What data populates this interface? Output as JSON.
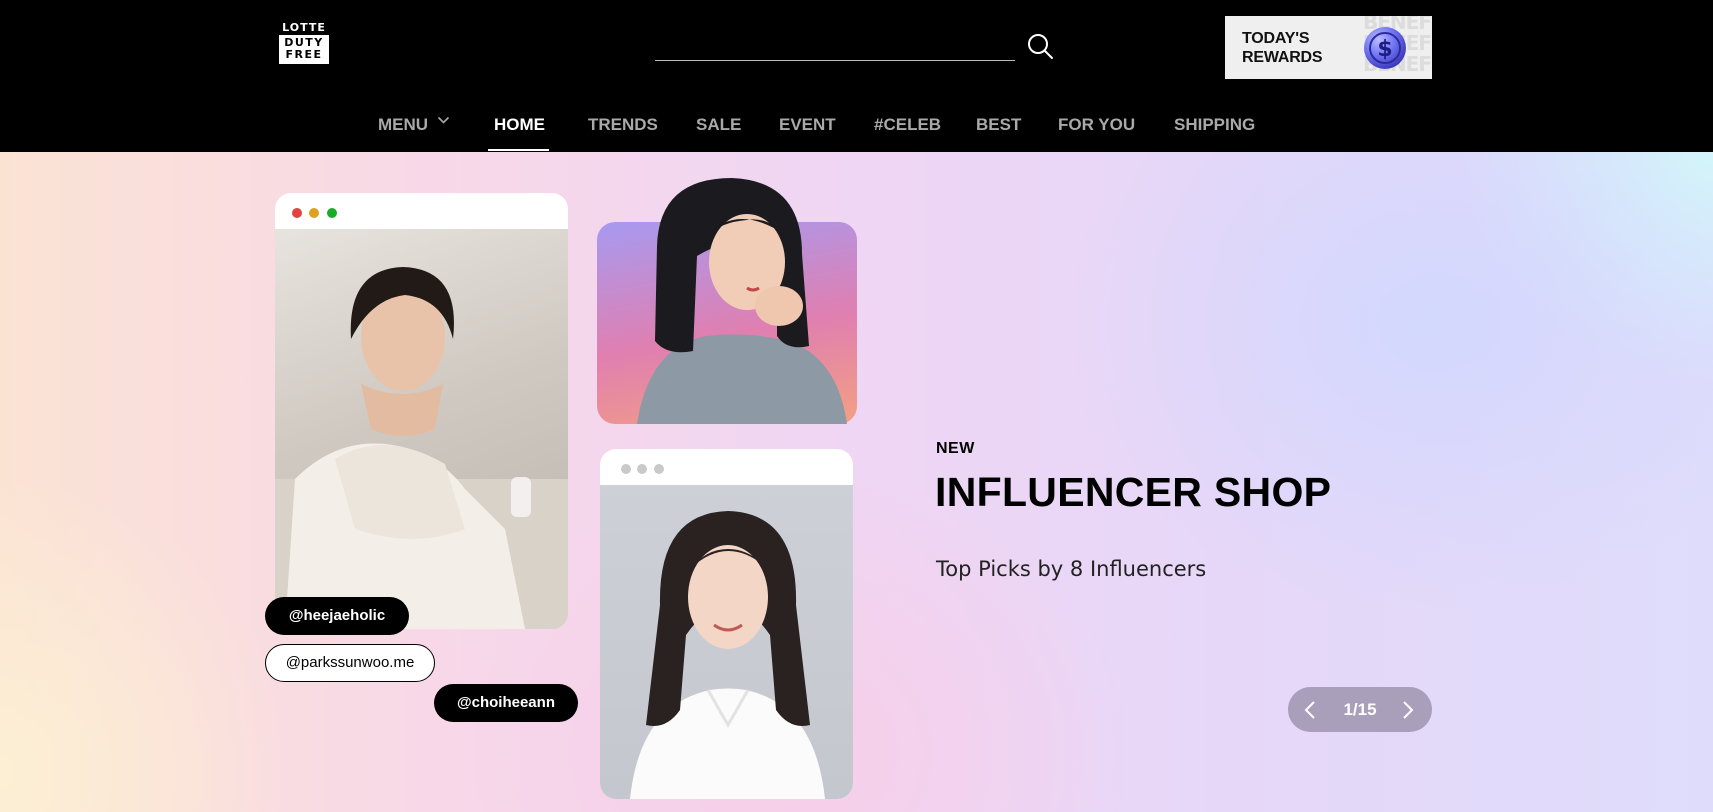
{
  "brand": {
    "logo_top": "LOTTE",
    "logo_line1": "DUTY",
    "logo_line2": "FREE"
  },
  "search": {
    "value": "",
    "placeholder": "",
    "icon": "search-icon"
  },
  "rewards_banner": {
    "line1": "TODAY'S",
    "line2": "REWARDS",
    "background_text": [
      "BENEFITS",
      "BENEFITS",
      "BENEFITS"
    ],
    "icon": "dollar-coin-icon",
    "coin_color": "#6a6ff0"
  },
  "nav": {
    "items": [
      {
        "label": "MENU"
      },
      {
        "label": "HOME"
      },
      {
        "label": "TRENDS"
      },
      {
        "label": "SALE"
      },
      {
        "label": "EVENT"
      },
      {
        "label": "#CELEB"
      },
      {
        "label": "BEST"
      },
      {
        "label": "FOR YOU"
      },
      {
        "label": "SHIPPING"
      }
    ],
    "active": "HOME"
  },
  "hero": {
    "eyebrow": "NEW",
    "title": "INFLUENCER SHOP",
    "subtitle": "Top Picks by 8 Influencers",
    "tags": [
      "@heejaeholic",
      "@parkssunwoo.me",
      "@choiheeann"
    ],
    "window_dot_colors": [
      "#e0443e",
      "#dea123",
      "#1aab29"
    ],
    "pager": {
      "current": 1,
      "total": 15,
      "label": "1/15"
    }
  },
  "colors": {
    "header_bg": "#000000",
    "pager_bg": "#aa9fbb"
  }
}
